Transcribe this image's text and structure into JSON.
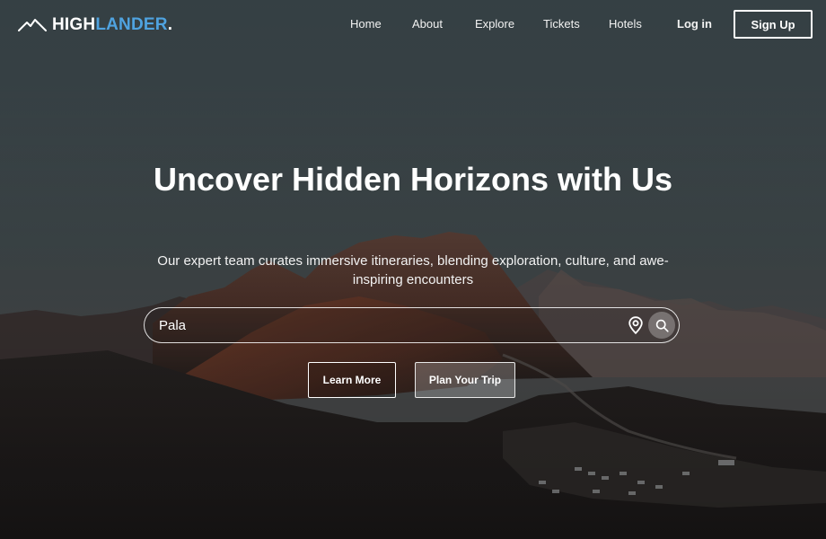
{
  "brand": {
    "part1": "HIGH",
    "part2": "LANDER",
    "part3": ".",
    "accent_color": "#4fa3e0",
    "logo_icon": "mountain-logo-icon"
  },
  "nav": {
    "links": [
      "Home",
      "About",
      "Explore",
      "Tickets",
      "Hotels"
    ],
    "login_label": "Log in",
    "signup_label": "Sign Up"
  },
  "hero": {
    "title": "Uncover Hidden Horizons with Us",
    "subtitle": "Our expert team curates immersive itineraries, blending exploration, culture, and awe-inspiring encounters"
  },
  "search": {
    "value": "Pala",
    "location_icon": "location-pin-icon",
    "search_icon": "search-icon"
  },
  "actions": {
    "learn_more_label": "Learn More",
    "plan_trip_label": "Plan Your Trip"
  }
}
